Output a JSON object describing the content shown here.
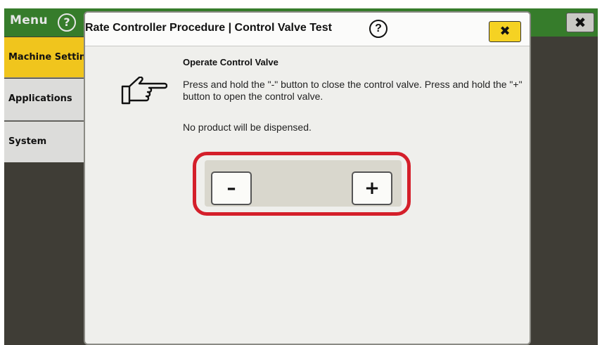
{
  "sidebar": {
    "menu_label": "Menu",
    "help_glyph": "?",
    "tabs": [
      {
        "label": "Machine Settings",
        "state": "selected"
      },
      {
        "label": "Applications"
      },
      {
        "label": "System"
      }
    ]
  },
  "window": {
    "close_glyph": "✖"
  },
  "dialog": {
    "title": "Rate Controller Procedure | Control Valve Test",
    "help_glyph": "?",
    "close_glyph": "✖",
    "section_title": "Operate Control Valve",
    "instructions": "Press and hold the \"-\" button to close the control valve. Press and hold the \"+\" button to open the control valve.",
    "note": "No product will be dispensed.",
    "controls": {
      "minus_label": "–",
      "plus_label": "+"
    },
    "hand_icon": "pointing-hand-icon"
  },
  "colors": {
    "header_green": "#367c2b",
    "selected_tab": "#f0c51d",
    "close_button": "#f5d223",
    "highlight_red": "#d41f2a"
  }
}
